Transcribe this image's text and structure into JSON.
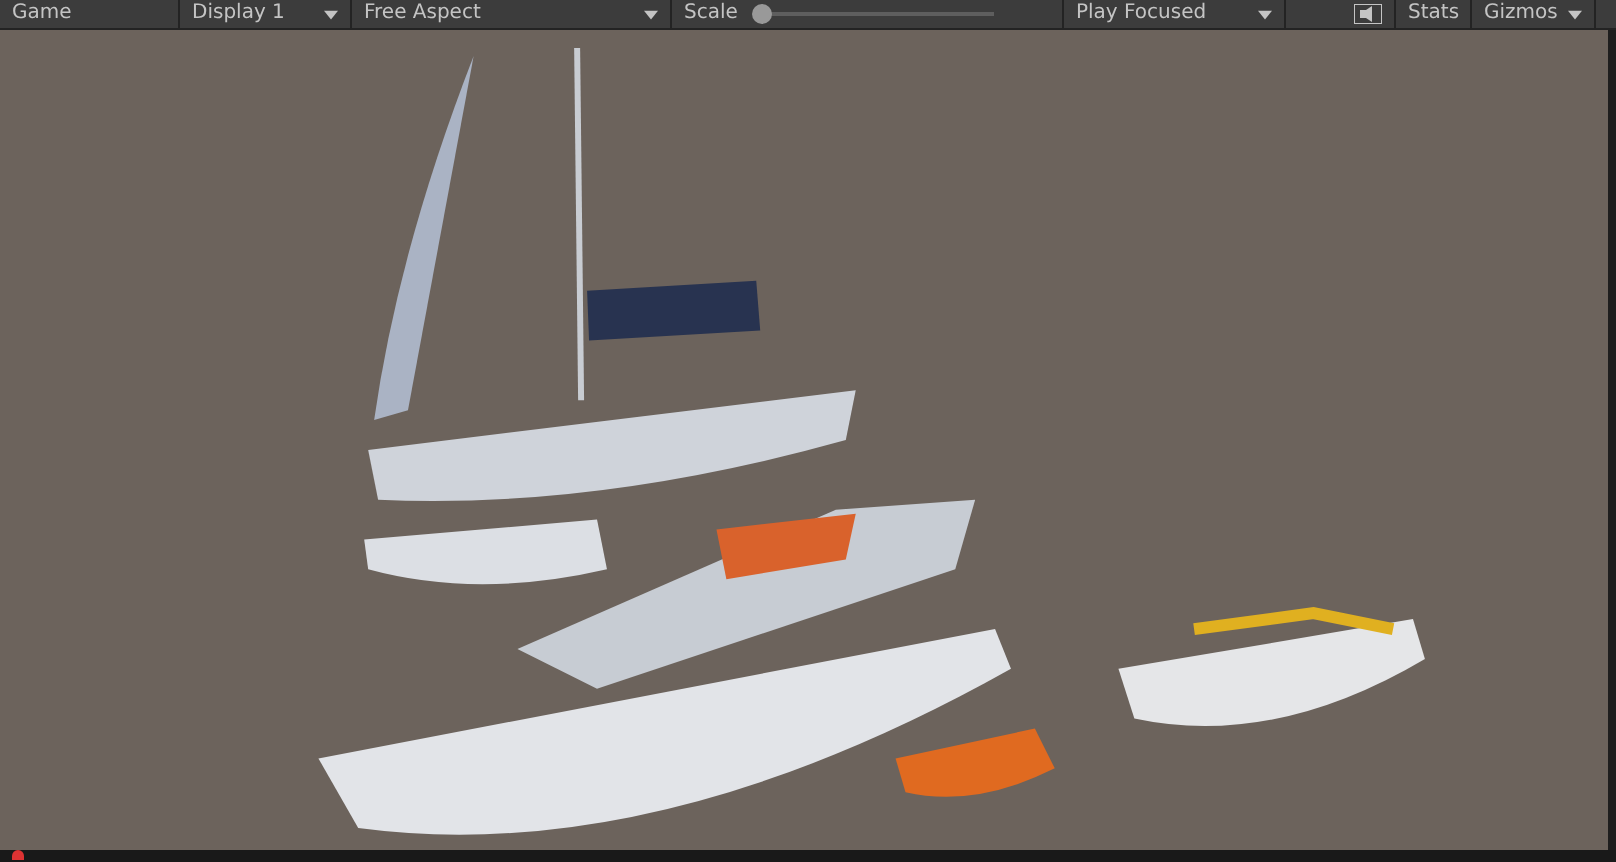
{
  "tab": {
    "label": "Game"
  },
  "toolbar": {
    "display": "Display 1",
    "aspect": "Free Aspect",
    "scale": {
      "label": "Scale",
      "level": 0
    },
    "play_mode": "Play Focused",
    "stats": "Stats",
    "gizmos": "Gizmos"
  }
}
